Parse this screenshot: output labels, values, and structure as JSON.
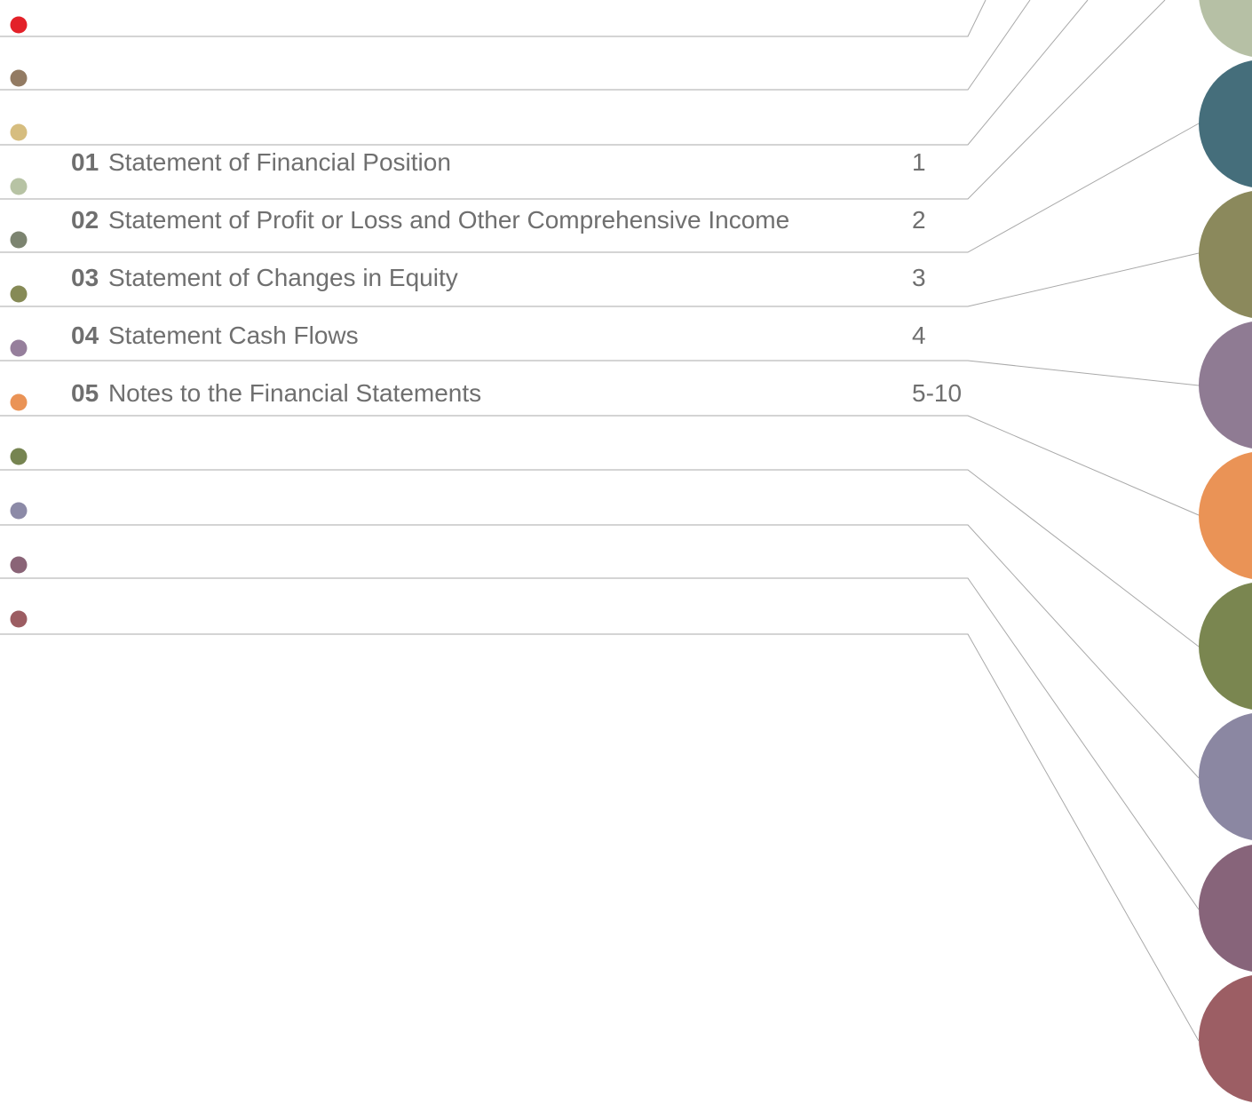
{
  "palette": {
    "line": "#a9a9a9",
    "text": "#6f6f6f"
  },
  "toc": {
    "entries": [
      {
        "number": "01",
        "title": "Statement of Financial Position",
        "page": "1"
      },
      {
        "number": "02",
        "title": "Statement of Profit or Loss and Other Comprehensive Income",
        "page": "2"
      },
      {
        "number": "03",
        "title": "Statement of Changes in Equity",
        "page": "3"
      },
      {
        "number": "04",
        "title": "Statement Cash Flows",
        "page": "4"
      },
      {
        "number": "05",
        "title": "Notes to the Financial Statements",
        "page": "5-10"
      }
    ]
  },
  "bullets": {
    "colors": [
      "#e32129",
      "#937b63",
      "#d6bd7f",
      "#b7c3a4",
      "#7c8470",
      "#868a56",
      "#967f9c",
      "#ea9356",
      "#768451",
      "#8c8aa7",
      "#8a6477",
      "#9c5d62"
    ]
  },
  "tabs": {
    "colors": [
      "#b6c0a5",
      "#456e7b",
      "#8b895c",
      "#8f7b93",
      "#ea9356",
      "#7a8650",
      "#8b87a2",
      "#87647a",
      "#9c5e64"
    ]
  }
}
